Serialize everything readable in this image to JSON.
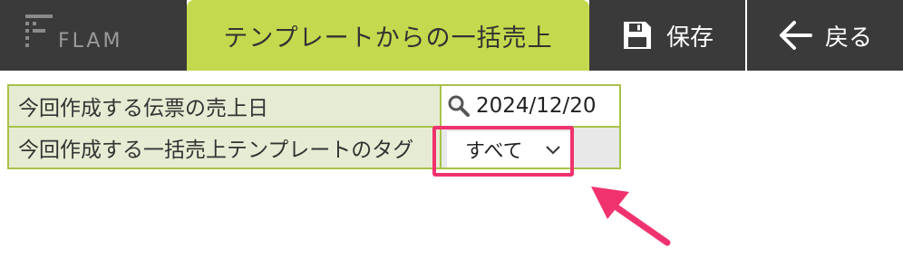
{
  "header": {
    "logo_text": "FLAM",
    "title": "テンプレートからの一括売上",
    "save_label": "保存",
    "back_label": "戻る"
  },
  "form": {
    "rows": [
      {
        "label": "今回作成する伝票の売上日",
        "value": "2024/12/20"
      },
      {
        "label": "今回作成する一括売上テンプレートのタグ",
        "value": "すべて"
      }
    ]
  },
  "colors": {
    "header_dark": "#3a3a3a",
    "accent_green": "#c5d94e",
    "table_border": "#a8c24a",
    "label_bg": "#e6ecd3",
    "highlight_pink": "#f0336e"
  },
  "icons": [
    "flam-logo",
    "save-icon",
    "back-arrow-icon",
    "search-icon",
    "chevron-down-icon",
    "pointer-arrow-icon"
  ]
}
